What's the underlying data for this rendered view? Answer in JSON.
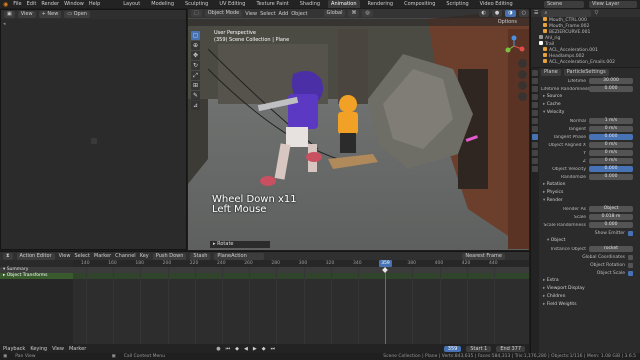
{
  "topbar": {
    "menus": [
      "File",
      "Edit",
      "Render",
      "Window",
      "Help"
    ],
    "workspaces": [
      "Layout",
      "Modeling",
      "Sculpting",
      "UV Editing",
      "Texture Paint",
      "Shading",
      "Animation",
      "Rendering",
      "Compositing",
      "Scripting",
      "Video Editing"
    ],
    "active_workspace": "Animation",
    "scene_label": "Scene",
    "view_layer_label": "View Layer"
  },
  "left_editor": {
    "new_label": "New",
    "open_label": "Open"
  },
  "viewport": {
    "mode": "Object Mode",
    "menus": [
      "View",
      "Select",
      "Add",
      "Object"
    ],
    "transform_orientation": "Global",
    "options_label": "Options",
    "info_line1": "User Perspective",
    "info_line2": "(359) Scene Collection | Plane",
    "overlay_line1": "Wheel Down x11",
    "overlay_line2": "Left Mouse",
    "status_label": "Rotate"
  },
  "outliner": {
    "items": [
      "Mouth_CTRL.000",
      "Mouth_Frame.002",
      "BEZIERCURVE.001",
      "Ahl_rig",
      "Trail",
      "ACL_Acceleration.001",
      "Headlamps.002",
      "ACL_Acceleration_Emails.002"
    ]
  },
  "properties": {
    "object_name": "Plane",
    "particle_settings_name": "ParticleSettings",
    "rows_top": [
      {
        "label": "Lifetime",
        "value": "30.000"
      },
      {
        "label": "Lifetime Randomness",
        "value": "0.000"
      }
    ],
    "sections_a": [
      "Source",
      "Cache",
      "Velocity"
    ],
    "velocity_rows": [
      {
        "label": "Normal",
        "value": "1 m/s",
        "blue": false
      },
      {
        "label": "Tangent",
        "value": "0 m/s",
        "blue": false
      },
      {
        "label": "Tangent Phase",
        "value": "0.000",
        "blue": true
      },
      {
        "label": "Object Aligned X",
        "value": "0 m/s",
        "blue": false
      },
      {
        "label": "Y",
        "value": "0 m/s",
        "blue": false
      },
      {
        "label": "Z",
        "value": "0 m/s",
        "blue": false
      },
      {
        "label": "Object Velocity",
        "value": "0.000",
        "blue": true
      },
      {
        "label": "Randomize",
        "value": "0.000",
        "blue": false
      }
    ],
    "sections_b": [
      "Rotation",
      "Physics",
      "Render"
    ],
    "render_as_label": "Render As",
    "render_as_value": "Object",
    "scale_label": "Scale",
    "scale_value": "0.018 m",
    "scale_rand_label": "Scale Randomness",
    "scale_rand_value": "0.000",
    "show_emitter_label": "Show Emitter",
    "object_section": "Object",
    "instance_object_label": "Instance Object",
    "instance_object_value": "rocket",
    "checks": [
      "Global Coordinates",
      "Object Rotation",
      "Object Scale"
    ],
    "sections_c": [
      "Extra",
      "Viewport Display",
      "Children",
      "Field Weights"
    ]
  },
  "timeline": {
    "editor_type": "Action Editor",
    "menus": [
      "View",
      "Select",
      "Marker",
      "Channel",
      "Key"
    ],
    "push_down": "Push Down",
    "stash": "Stash",
    "action_name": "PlaneAction",
    "nearest_frame": "Nearest Frame",
    "ticks": [
      "140",
      "160",
      "180",
      "200",
      "220",
      "240",
      "260",
      "280",
      "300",
      "320",
      "340",
      "359",
      "380",
      "400",
      "420",
      "440"
    ],
    "current_frame": "359",
    "channels": [
      "Summary",
      "Object Transforms"
    ]
  },
  "playbar": {
    "menus": [
      "Playback",
      "Keying",
      "View",
      "Marker"
    ],
    "current": "359",
    "start_label": "Start",
    "start_value": "1",
    "end_label": "End",
    "end_value": "377"
  },
  "statusbar": {
    "left": "Pan View",
    "mid": "Call Context Menu",
    "right": "Scene Collection | Plane | Verts:843,635 | Faces:584,313 | Tris:1,176,280 | Objects:1/116 | Mem: 1.08 GiB | 3.6.5"
  }
}
